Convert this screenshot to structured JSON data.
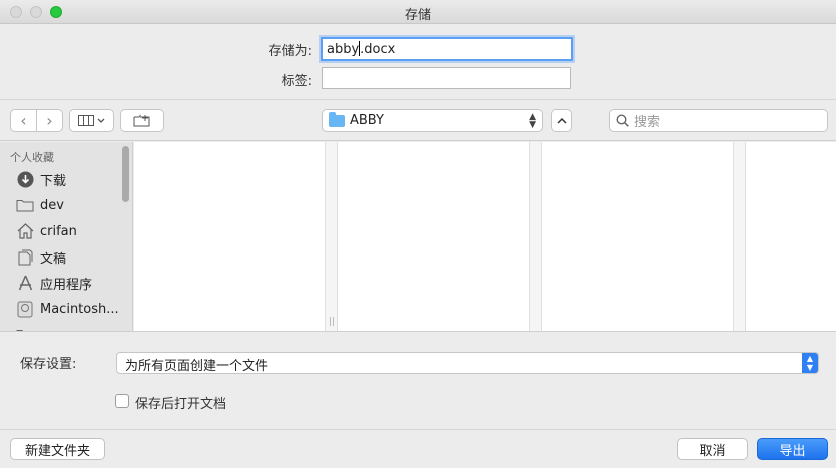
{
  "window": {
    "title": "存储"
  },
  "save_form": {
    "save_as_label": "存储为:",
    "filename_before_caret": "abby",
    "filename_after_caret": ".docx",
    "tags_label": "标签:",
    "tags_value": ""
  },
  "toolbar": {
    "back_icon": "chevron-left-icon",
    "forward_icon": "chevron-right-icon",
    "view_icon": "column-view-icon",
    "view_chevron": "chevron-down-icon",
    "new_folder_icon": "new-folder-icon",
    "location": "ABBY",
    "expand_icon": "chevron-up-icon",
    "search_placeholder": "搜索"
  },
  "sidebar": {
    "section_title": "个人收藏",
    "items": [
      {
        "label": "下载",
        "icon": "download-icon"
      },
      {
        "label": "dev",
        "icon": "folder-icon"
      },
      {
        "label": "crifan",
        "icon": "home-icon"
      },
      {
        "label": "文稿",
        "icon": "document-icon"
      },
      {
        "label": "应用程序",
        "icon": "applications-icon"
      },
      {
        "label": "Macintosh...",
        "icon": "disk-icon"
      }
    ]
  },
  "options": {
    "save_settings_label": "保存设置:",
    "save_settings_value": "为所有页面创建一个文件",
    "open_after_save_label": "保存后打开文档",
    "open_after_save_checked": false
  },
  "footer": {
    "new_folder_label": "新建文件夹",
    "cancel_label": "取消",
    "export_label": "导出"
  },
  "colors": {
    "accent": "#2f7ff5",
    "folder": "#69b6f5",
    "close_button_green": "#27c93f"
  }
}
